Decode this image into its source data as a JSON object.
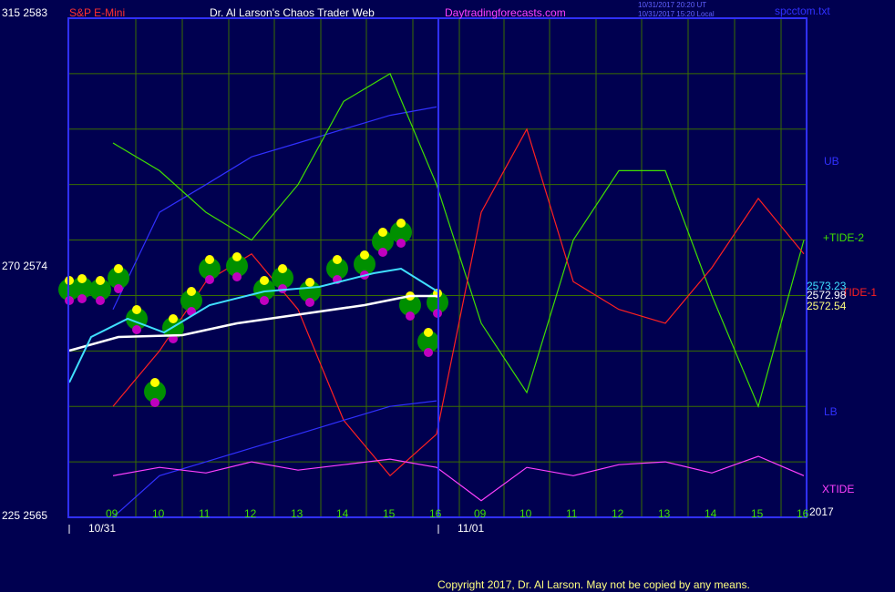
{
  "header": {
    "left_scale": "315  2583",
    "symbol": "S&P E-Mini",
    "title": "Dr. Al Larson's Chaos Trader Web",
    "site": "Daytradingforecasts.com",
    "ts1": "10/31/2017  20:20  UT",
    "ts2": "10/31/2017  15:20  Local",
    "file": "spcctom.txt"
  },
  "footer": {
    "copyright": "Copyright 2017, Dr. Al Larson. May not be copied by any means."
  },
  "y_axis": {
    "mid": "270  2574",
    "bottom": "225  2565"
  },
  "right_labels": {
    "ub": "UB",
    "tide2": "+TIDE-2",
    "tide1": "TIDE-1",
    "lb": "LB",
    "xtide": "XTIDE",
    "p1": "2573.23",
    "p2": "2572.98",
    "p3": "2572.54"
  },
  "x_axis": {
    "hours": [
      "09",
      "10",
      "11",
      "12",
      "13",
      "14",
      "15",
      "16",
      "09",
      "10",
      "11",
      "12",
      "13",
      "14",
      "15",
      "16"
    ],
    "day1": "10/31",
    "day2": "11/01",
    "year": "2017"
  },
  "colors": {
    "bg": "#000050",
    "frame": "#3030ff",
    "grid": "#3a6e00",
    "symbol": "#ff3030",
    "title": "#ffffff",
    "site": "#ff40ff",
    "ts": "#6060ff",
    "ub": "#3030ff",
    "tide2": "#40e000",
    "tide1": "#ff2020",
    "p1": "#40e0ff",
    "p2": "#ffffff",
    "p3": "#ffff80",
    "xtide": "#ff40ff",
    "axis_text": "#40e000",
    "footer": "#ffff80",
    "yellow": "#ffff00",
    "white": "#ffffff"
  },
  "chart_data": {
    "type": "line",
    "title": "Dr. Al Larson's Chaos Trader Web",
    "ylim": [
      2565,
      2583
    ],
    "categories": [
      "09",
      "10",
      "11",
      "12",
      "13",
      "14",
      "15",
      "16",
      "09",
      "10",
      "11",
      "12",
      "13",
      "14",
      "15",
      "16"
    ],
    "series": [
      {
        "name": "UB",
        "values": [
          2572.5,
          2576.0,
          2577.0,
          2578.0,
          2578.5,
          2579.0,
          2579.5,
          2579.8
        ]
      },
      {
        "name": "+TIDE-2",
        "values": [
          2578.5,
          2577.5,
          2576.0,
          2575.0,
          2577.0,
          2580.0,
          2581.0,
          2577.0,
          2572.0,
          2569.5,
          2575.0,
          2577.5,
          2577.5,
          2573.0,
          2569.0,
          2575.0
        ]
      },
      {
        "name": "TIDE-1",
        "values": [
          2569.0,
          2571.0,
          2573.5,
          2574.5,
          2572.5,
          2568.5,
          2566.5,
          2568.0,
          2576.0,
          2579.0,
          2573.5,
          2572.5,
          2572.0,
          2574.0,
          2576.5,
          2574.5
        ]
      },
      {
        "name": "LB",
        "values": [
          2565.0,
          2566.5,
          2567.0,
          2567.5,
          2568.0,
          2568.5,
          2569.0,
          2569.2
        ]
      },
      {
        "name": "XTIDE",
        "values": [
          2566.5,
          2566.8,
          2566.6,
          2567.0,
          2566.7,
          2566.9,
          2567.1,
          2566.8,
          2565.6,
          2566.8,
          2566.5,
          2566.9,
          2567.0,
          2566.6,
          2567.2,
          2566.5
        ]
      }
    ]
  }
}
